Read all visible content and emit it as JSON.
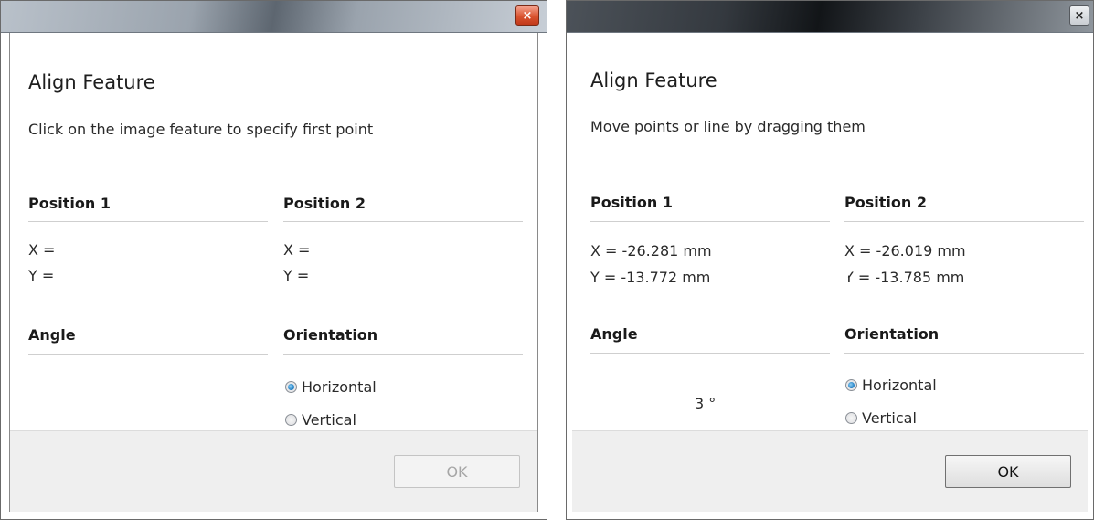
{
  "left_dialog": {
    "heading": "Align Feature",
    "instruction": "Click on the image feature to specify first point",
    "position1": {
      "label": "Position 1",
      "x": "X =",
      "y": "Y ="
    },
    "position2": {
      "label": "Position 2",
      "x": "X =",
      "y": "Y ="
    },
    "angle": {
      "label": "Angle",
      "value": ""
    },
    "orientation": {
      "label": "Orientation",
      "options": [
        "Horizontal",
        "Vertical"
      ],
      "selected": "Horizontal"
    },
    "ok_label": "OK",
    "ok_enabled": false,
    "close_glyph": "×"
  },
  "right_dialog": {
    "heading": "Align Feature",
    "instruction": "Move points or line by dragging them",
    "position1": {
      "label": "Position 1",
      "x": "X = -26.281 mm",
      "y": "Y = -13.772 mm"
    },
    "position2": {
      "label": "Position 2",
      "x": "X = -26.019 mm",
      "y": "Y = -13.785 mm"
    },
    "angle": {
      "label": "Angle",
      "value": "3 °"
    },
    "orientation": {
      "label": "Orientation",
      "options": [
        "Horizontal",
        "Vertical"
      ],
      "selected": "Horizontal"
    },
    "ok_label": "OK",
    "ok_enabled": true,
    "close_glyph": "×"
  },
  "colors": {
    "radio_checked": "#2b86c9",
    "close_active": "#d9532f",
    "footer_bg": "#efefef",
    "disabled_text": "#a6a6a6"
  }
}
